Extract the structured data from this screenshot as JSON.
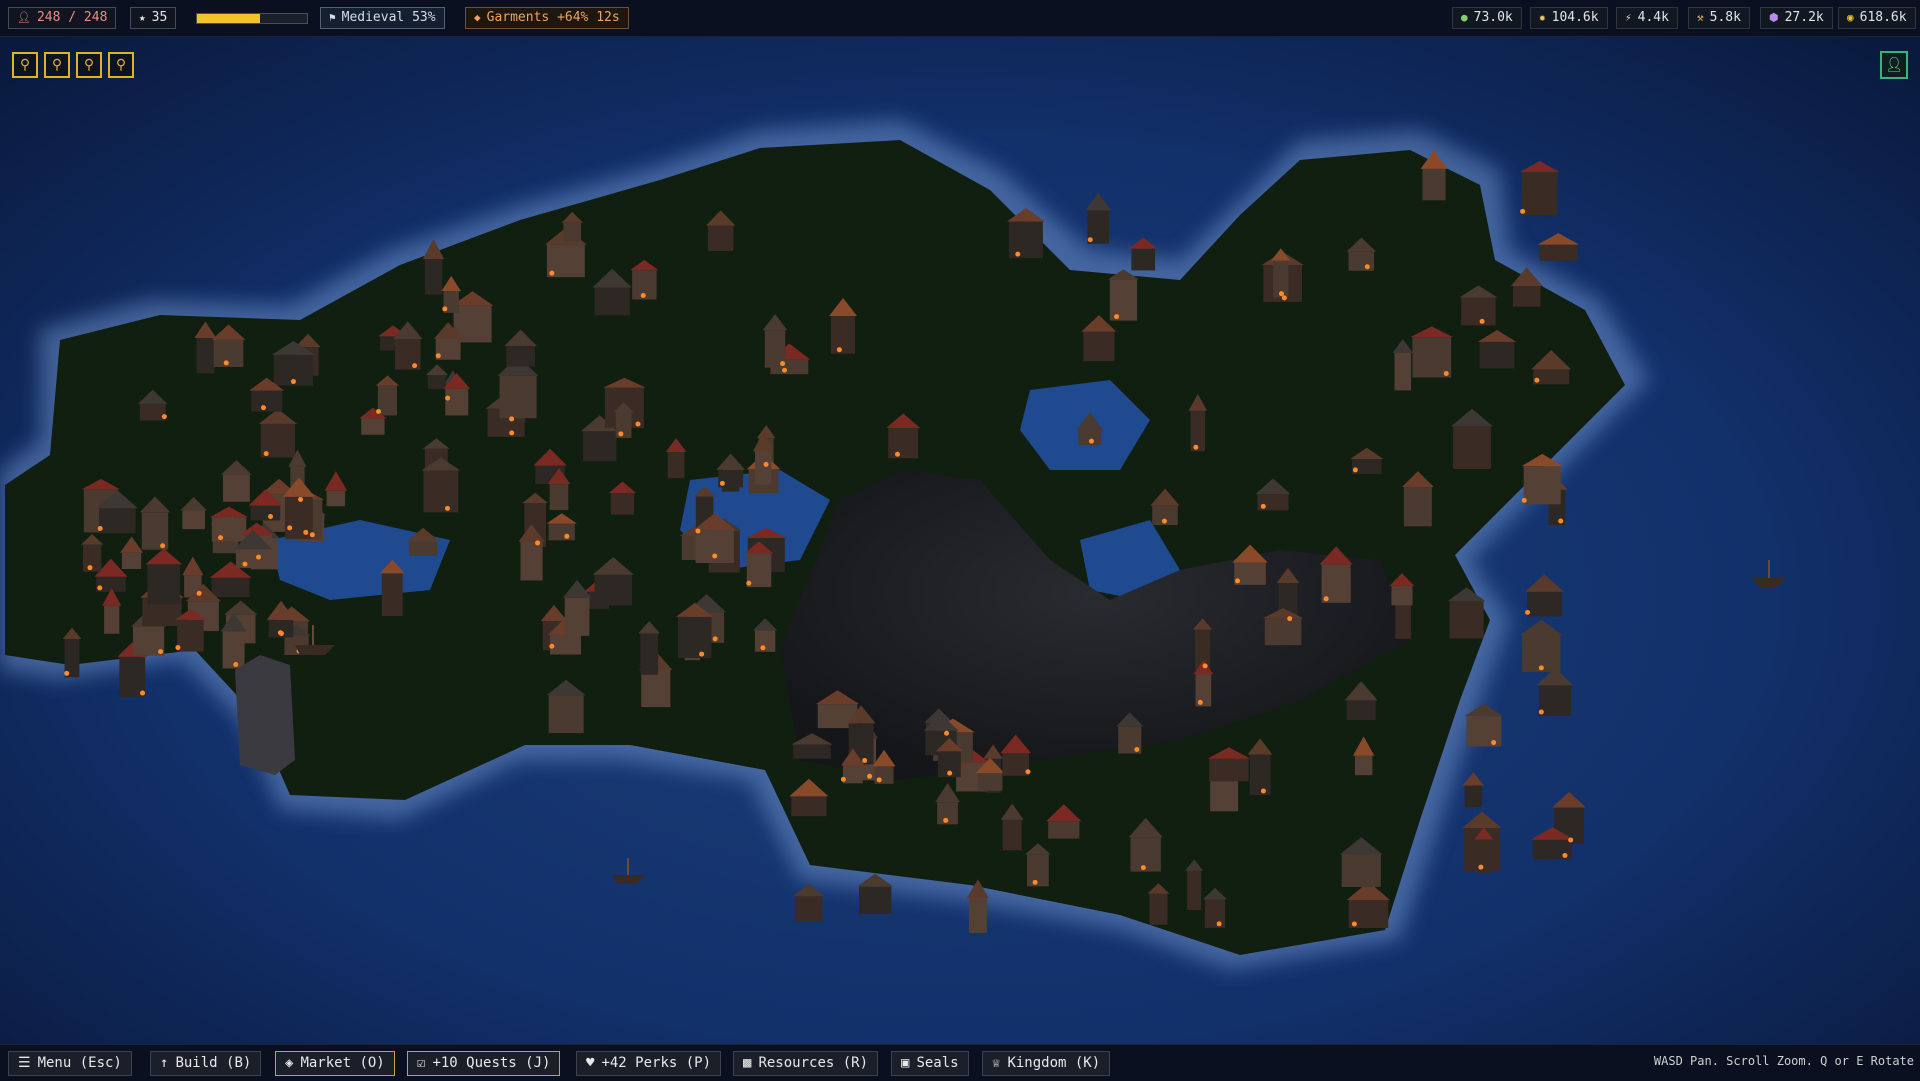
{
  "hud": {
    "population": "248 / 248",
    "level": "35",
    "xp_progress": 0.57,
    "era": "Medieval 53%",
    "boost": "Garments +64% 12s",
    "icons": {
      "population": "person-icon",
      "level": "star-icon",
      "era": "flag-icon",
      "boost": "diamond-icon"
    },
    "colors": {
      "xp_fill": "#f2c230",
      "population_text": "#f08a84",
      "boost_text": "#f0a460"
    }
  },
  "resources": [
    {
      "name": "food",
      "icon": "leaf-icon",
      "color": "#7fd36a",
      "value": "73.0k"
    },
    {
      "name": "wood",
      "icon": "cog-icon",
      "color": "#f1c66a",
      "value": "104.6k"
    },
    {
      "name": "energy",
      "icon": "bolt-icon",
      "color": "#d9dde4",
      "value": "4.4k"
    },
    {
      "name": "tools",
      "icon": "wrench-icon",
      "color": "#e4b07a",
      "value": "5.8k"
    },
    {
      "name": "crystal",
      "icon": "gem-icon",
      "color": "#b48cf0",
      "value": "27.2k"
    },
    {
      "name": "gold",
      "icon": "coin-icon",
      "color": "#f2c230",
      "value": "618.6k"
    }
  ],
  "zoom_buttons": [
    "zoom-icon",
    "zoom-icon",
    "zoom-icon",
    "zoom-icon"
  ],
  "profile": {
    "icon": "person-icon"
  },
  "bottom": {
    "buttons": [
      {
        "id": "menu",
        "icon": "menu-icon",
        "label": "Menu (Esc)",
        "highlight": false
      },
      {
        "id": "build",
        "icon": "hammer-icon",
        "label": "Build (B)",
        "highlight": false
      },
      {
        "id": "market",
        "icon": "tag-icon",
        "label": "Market (O)",
        "highlight": true
      },
      {
        "id": "quests",
        "icon": "checkbox-icon",
        "label": "+10 Quests (J)",
        "highlight": true
      },
      {
        "id": "perks",
        "icon": "heart-icon",
        "label": "+42 Perks (P)",
        "highlight": false
      },
      {
        "id": "resources",
        "icon": "bar-chart-icon",
        "label": "Resources (R)",
        "highlight": false
      },
      {
        "id": "seals",
        "icon": "book-icon",
        "label": "Seals",
        "highlight": false
      },
      {
        "id": "kingdom",
        "icon": "crown-icon",
        "label": "Kingdom (K)",
        "highlight": false
      }
    ],
    "hint": "WASD Pan. Scroll Zoom. Q or E Rotate"
  }
}
